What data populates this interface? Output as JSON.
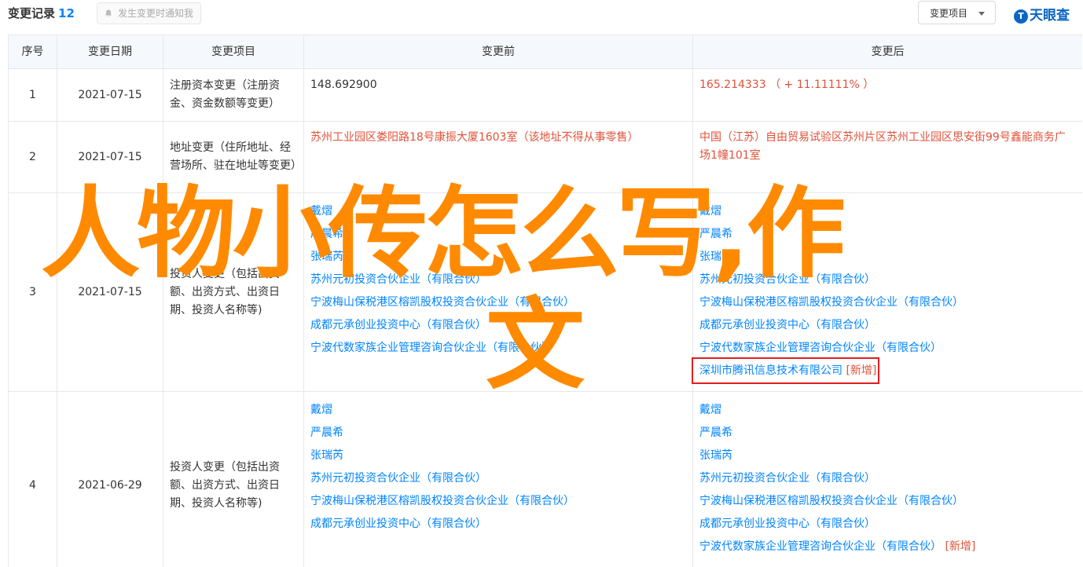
{
  "header": {
    "title": "变更记录",
    "count": "12",
    "notify_label": "发生变更时通知我",
    "dropdown_label": "变更项目",
    "logo": "天眼查"
  },
  "table": {
    "columns": [
      "序号",
      "变更日期",
      "变更项目",
      "变更前",
      "变更后"
    ],
    "rows": [
      {
        "no": "1",
        "date": "2021-07-15",
        "item": "注册资本变更（注册资金、资金数额等变更）",
        "before": "148.692900",
        "after": "165.214333 （ + 11.11111% ）"
      },
      {
        "no": "2",
        "date": "2021-07-15",
        "item": "地址变更（住所地址、经营场所、驻在地址等变更）",
        "before": "苏州工业园区娄阳路18号康振大厦1603室（该地址不得从事零售）",
        "after": "中国（江苏）自由贸易试验区苏州片区苏州工业园区思安街99号鑫能商务广场1幢101室"
      },
      {
        "no": "3",
        "date": "2021-07-15",
        "item": "投资人变更（包括出资额、出资方式、出资日期、投资人名称等)",
        "before": [
          "戴熠",
          "严晨希",
          "张瑞芮",
          "苏州元初投资合伙企业（有限合伙）",
          "宁波梅山保税港区榕凯股权投资合伙企业（有限合伙）",
          "成都元承创业投资中心（有限合伙）",
          "宁波代数家族企业管理咨询合伙企业（有限合伙）"
        ],
        "after": [
          "戴熠",
          "严晨希",
          "张瑞芮",
          "苏州元初投资合伙企业（有限合伙）",
          "宁波梅山保税港区榕凯股权投资合伙企业（有限合伙）",
          "成都元承创业投资中心（有限合伙）",
          "宁波代数家族企业管理咨询合伙企业（有限合伙）",
          "深圳市腾讯信息技术有限公司"
        ],
        "after_new_tag": "[新增]"
      },
      {
        "no": "4",
        "date": "2021-06-29",
        "item": "投资人变更（包括出资额、出资方式、出资日期、投资人名称等)",
        "before": [
          "戴熠",
          "严晨希",
          "张瑞芮",
          "苏州元初投资合伙企业（有限合伙）",
          "宁波梅山保税港区榕凯股权投资合伙企业（有限合伙）",
          "成都元承创业投资中心（有限合伙）"
        ],
        "after": [
          "戴熠",
          "严晨希",
          "张瑞芮",
          "苏州元初投资合伙企业（有限合伙）",
          "宁波梅山保税港区榕凯股权投资合伙企业（有限合伙）",
          "成都元承创业投资中心（有限合伙）",
          "宁波代数家族企业管理咨询合伙企业（有限合伙）"
        ],
        "after_new_tag": "[新增]"
      }
    ]
  },
  "watermark": {
    "line1": "人物小传怎么写,作",
    "line2": "文"
  },
  "colors": {
    "accent": "#0084ff",
    "change_red": "#e0523a",
    "highlight_box": "#e21d1d",
    "watermark": "#ff8a00",
    "header_bg": "#f5f8fc"
  }
}
